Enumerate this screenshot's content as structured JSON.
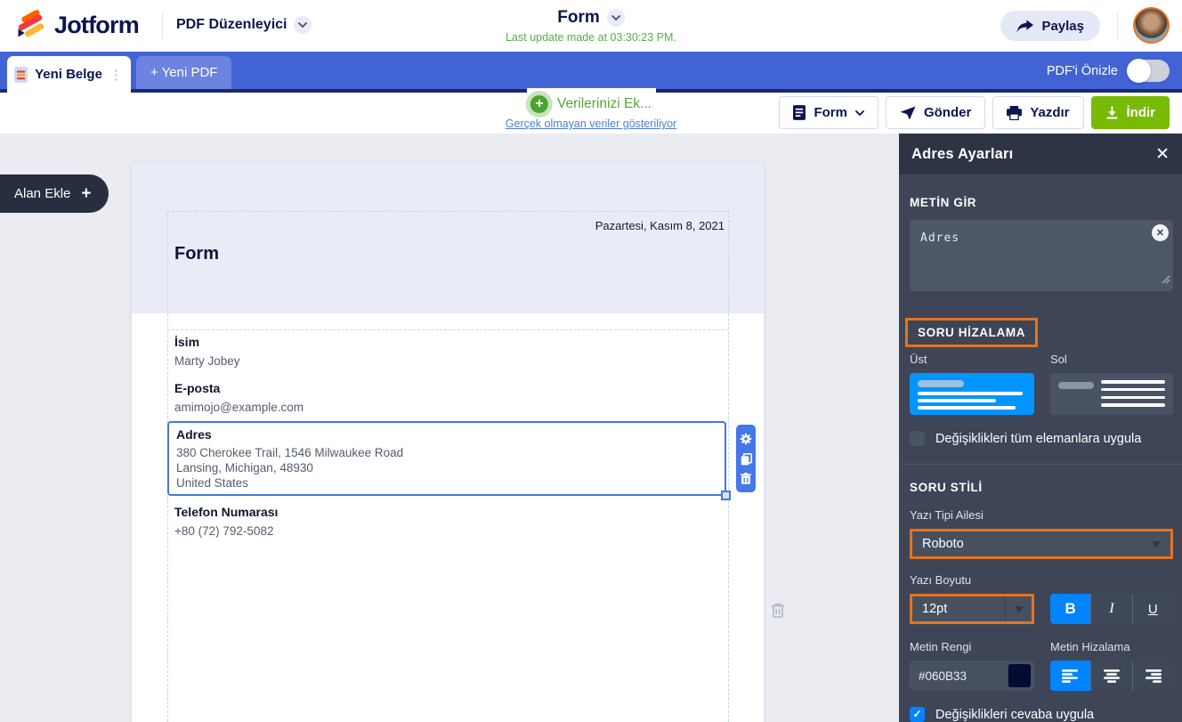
{
  "app": {
    "brand": "Jotform",
    "product_menu": "PDF Düzenleyici",
    "title": "Form",
    "last_update": "Last update made at 03:30:23 PM.",
    "share": "Paylaş"
  },
  "tabs": {
    "active_tab": "Yeni Belge",
    "new_pdf": "+ Yeni PDF",
    "preview_toggle": "PDF'i Önizle",
    "preview_on": false
  },
  "toolbar": {
    "add_data": "Verilerinizi Ek...",
    "sample_data_notice": "Gerçek olmayan veriler gösteriliyor",
    "form": "Form",
    "send": "Gönder",
    "print": "Yazdır",
    "download": "İndir"
  },
  "canvas": {
    "add_field": "Alan Ekle",
    "document": {
      "date": "Pazartesi, Kasım 8, 2021",
      "title": "Form",
      "fields": [
        {
          "label": "İsim",
          "value": "Marty Jobey"
        },
        {
          "label": "E-posta",
          "value": "amimojo@example.com"
        },
        {
          "label": "Adres",
          "selected": true,
          "value_lines": [
            "380 Cherokee Trail, 1546 Milwaukee Road",
            "Lansing, Michigan, 48930",
            "United States"
          ]
        },
        {
          "label": "Telefon Numarası",
          "value": "+80 (72) 792-5082"
        }
      ]
    }
  },
  "panel": {
    "title": "Adres Ayarları",
    "enter_text": {
      "label": "METİN GİR",
      "value": "Adres"
    },
    "question_alignment": {
      "label": "SORU HİZALAMA",
      "options": [
        {
          "label": "Üst",
          "selected": true
        },
        {
          "label": "Sol",
          "selected": false
        }
      ],
      "apply_all": {
        "label": "Değişiklikleri tüm elemanlara uygula",
        "checked": false
      }
    },
    "question_style": {
      "label": "SORU STİLİ",
      "font_family": {
        "label": "Yazı Tipi Ailesi",
        "value": "Roboto"
      },
      "font_size": {
        "label": "Yazı Boyutu",
        "value": "12pt"
      },
      "bold": "B",
      "italic": "I",
      "underline": "U",
      "bold_active": true,
      "text_color": {
        "label": "Metin Rengi",
        "value": "#060B33"
      },
      "text_align": {
        "label": "Metin Hizalama",
        "active": "left"
      },
      "apply_answer": {
        "label": "Değişiklikleri cevaba uygula",
        "checked": true
      }
    }
  },
  "glyphs": {
    "plus": "+",
    "close": "✕",
    "clear": "✕",
    "dots": "⋮",
    "check": "✓"
  },
  "colors": {
    "brand_navy": "#0A1551",
    "tab_bar_blue": "#4263D3",
    "download_green": "#78BB07",
    "update_green": "#54B045",
    "highlight_orange": "#E8731C",
    "active_blue": "#0084FF",
    "selection_blue": "#4478E8",
    "align_top_card_blue": "#0095FF",
    "text_color_swatch": "#060B33"
  }
}
